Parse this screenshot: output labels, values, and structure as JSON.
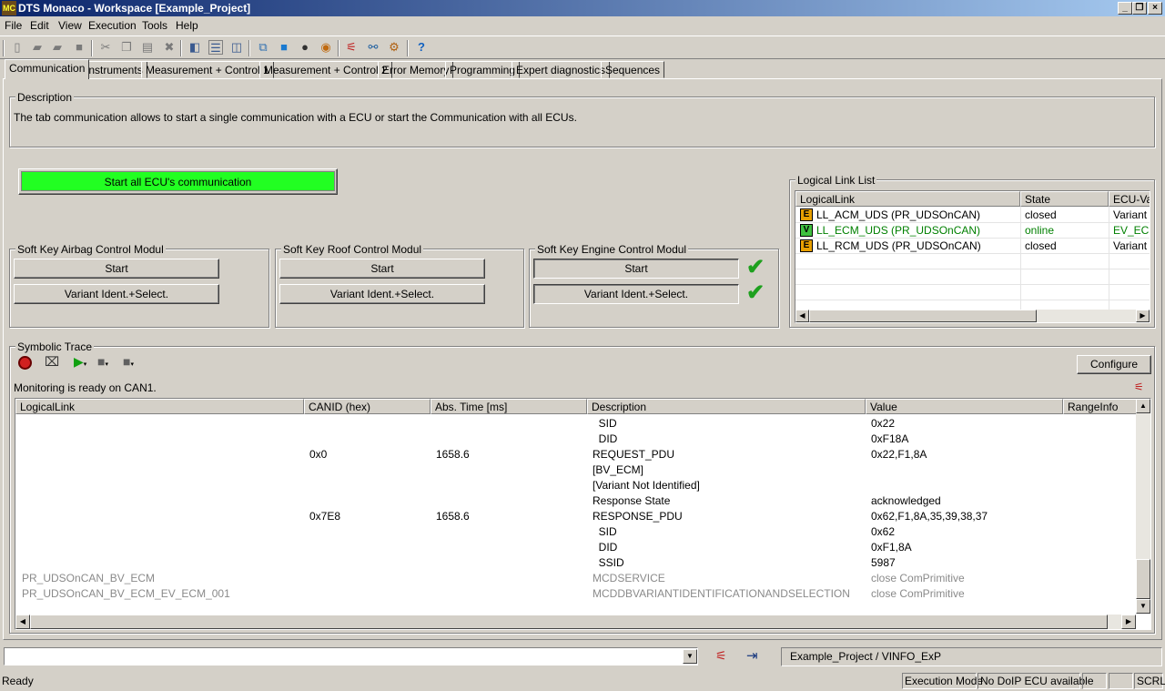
{
  "window": {
    "title": "DTS Monaco  - Workspace [Example_Project]",
    "logo": "MC"
  },
  "menu": [
    "File",
    "Edit",
    "View",
    "Execution",
    "Tools",
    "Help"
  ],
  "tabs": [
    "Communication",
    "Instruments",
    "Measurement + Control 1",
    "Measurement + Control 2",
    "Error Memory",
    "Programming",
    "Expert diagnostics",
    "Sequences"
  ],
  "description": {
    "label": "Description",
    "text": "The tab communication allows to start a single communication with a ECU or start the Communication with all ECUs."
  },
  "start_all_label": "Start all ECU's communication",
  "accent_green": "#22ff22",
  "soft_keys": [
    {
      "title": "Soft Key Airbag Control Modul",
      "start": "Start",
      "variant": "Variant Ident.+Select."
    },
    {
      "title": "Soft Key Roof Control Modul",
      "start": "Start",
      "variant": "Variant Ident.+Select."
    },
    {
      "title": "Soft Key Engine Control Modul",
      "start": "Start",
      "variant": "Variant Ident.+Select."
    }
  ],
  "logical_link_list": {
    "label": "Logical Link List",
    "headers": [
      "LogicalLink",
      "State",
      "ECU-Va"
    ],
    "rows": [
      {
        "badge": "E",
        "name": "LL_ACM_UDS (PR_UDSOnCAN)",
        "state": "closed",
        "ecu": "Variant n"
      },
      {
        "badge": "V",
        "name": "LL_ECM_UDS (PR_UDSOnCAN)",
        "state": "online",
        "ecu": "EV_ECM"
      },
      {
        "badge": "E",
        "name": "LL_RCM_UDS (PR_UDSOnCAN)",
        "state": "closed",
        "ecu": "Variant n"
      }
    ]
  },
  "trace": {
    "label": "Symbolic Trace",
    "configure": "Configure",
    "status": "Monitoring is ready on CAN1.",
    "headers": [
      "LogicalLink",
      "CANID (hex)",
      "Abs. Time [ms]",
      "Description",
      "Value",
      "RangeInfo"
    ],
    "rows": [
      {
        "link": "",
        "canid": "",
        "time": "",
        "desc": "  SID",
        "value": "0x22",
        "gray": false
      },
      {
        "link": "",
        "canid": "",
        "time": "",
        "desc": "  DID",
        "value": "0xF18A",
        "gray": false
      },
      {
        "link": "",
        "canid": "0x0",
        "time": "1658.6",
        "desc": "REQUEST_PDU",
        "value": "0x22,F1,8A",
        "gray": false
      },
      {
        "link": "",
        "canid": "",
        "time": "",
        "desc": "[BV_ECM]",
        "value": "",
        "gray": false
      },
      {
        "link": "",
        "canid": "",
        "time": "",
        "desc": "[Variant Not Identified]",
        "value": "",
        "gray": false
      },
      {
        "link": "",
        "canid": "",
        "time": "",
        "desc": "Response State",
        "value": "acknowledged",
        "gray": false
      },
      {
        "link": "",
        "canid": "0x7E8",
        "time": "1658.6",
        "desc": "RESPONSE_PDU",
        "value": "0x62,F1,8A,35,39,38,37",
        "gray": false
      },
      {
        "link": "",
        "canid": "",
        "time": "",
        "desc": "  SID",
        "value": "0x62",
        "gray": false
      },
      {
        "link": "",
        "canid": "",
        "time": "",
        "desc": "  DID",
        "value": "0xF1,8A",
        "gray": false
      },
      {
        "link": "",
        "canid": "",
        "time": "",
        "desc": "  SSID",
        "value": "5987",
        "gray": false
      },
      {
        "link": "PR_UDSOnCAN_BV_ECM",
        "canid": "",
        "time": "",
        "desc": "MCDSERVICE",
        "value": "close ComPrimitive",
        "gray": true
      },
      {
        "link": "PR_UDSOnCAN_BV_ECM_EV_ECM_001",
        "canid": "",
        "time": "",
        "desc": "MCDDBVARIANTIDENTIFICATIONANDSELECTION",
        "value": "close ComPrimitive",
        "gray": true
      }
    ]
  },
  "bottom": {
    "command_value": "",
    "project_path": "Example_Project / VINFO_ExP"
  },
  "statusbar": {
    "ready": "Ready",
    "mode": "Execution Mode",
    "doip": "No DoIP ECU available",
    "scrl": "SCRL"
  }
}
